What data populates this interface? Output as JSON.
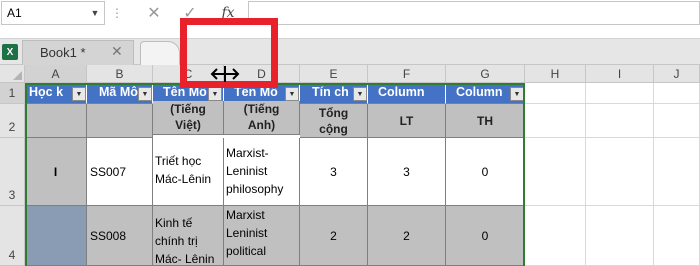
{
  "formula_bar": {
    "name_box": "A1",
    "fx_label": "fx",
    "cancel_glyph": "✕",
    "enter_glyph": "✓",
    "formula_value": ""
  },
  "workbook": {
    "tab_label": "Book1 *",
    "close_glyph": "✕",
    "app_icon_letter": "X"
  },
  "columns": [
    "A",
    "B",
    "C",
    "D",
    "E",
    "F",
    "G",
    "H",
    "I",
    "J"
  ],
  "rows": [
    "1",
    "2",
    "3",
    "4"
  ],
  "table": {
    "headers": [
      "Học k",
      "Mã Mô",
      "Tên Mô",
      "Tên Mô",
      "Tín ch",
      "Column",
      "Column"
    ],
    "subheaders": [
      "",
      "",
      "(Tiếng\nViệt)",
      "(Tiếng\nAnh)",
      "Tổng\ncộng",
      "LT",
      "TH"
    ],
    "rows": [
      [
        "I",
        "SS007",
        "Triết học\nMác-Lênin",
        "Marxist-\nLeninist\nphilosophy",
        "3",
        "3",
        "0"
      ],
      [
        "",
        "SS008",
        "Kinh tế\nchính trị\nMác- Lênin",
        "Marxist\nLeninist\npolitical\neconomy",
        "2",
        "2",
        "0"
      ]
    ]
  },
  "colors": {
    "header_blue": "#4472c4",
    "table_border": "#2e7d32",
    "highlight_red": "#e8212b"
  },
  "icons": {
    "resize_cursor": "column-resize-cursor-icon"
  }
}
